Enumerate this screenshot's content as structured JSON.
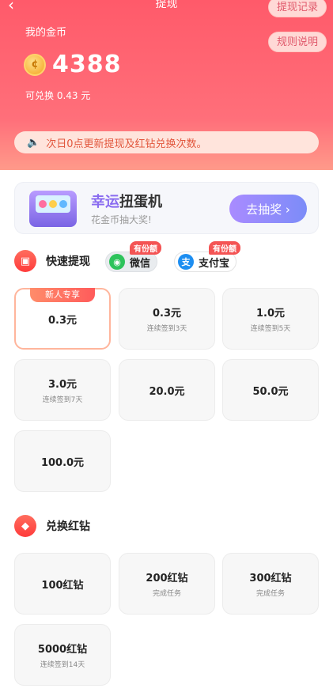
{
  "header": {
    "back_icon": "chevron-left-icon",
    "title": "提现",
    "record_button": "提现记录",
    "rules_button": "规则说明",
    "coin_label": "我的金币",
    "coin_value": "4388",
    "exchange_text": "可兑换 0.43 元",
    "notice": "次日0点更新提现及红钻兑换次数。"
  },
  "lottery": {
    "title_accent": "幸运",
    "title_rest": "扭蛋机",
    "subtitle": "花金币抽大奖!",
    "button": "去抽奖 ›"
  },
  "withdraw": {
    "title": "快速提现",
    "methods": [
      {
        "label": "微信",
        "tag": "有份额",
        "icon": "wechat-icon"
      },
      {
        "label": "支付宝",
        "tag": "有份额",
        "icon": "alipay-icon"
      }
    ],
    "options": [
      {
        "amount": "0.3元",
        "sub": "",
        "badge": "新人专享",
        "selected": true
      },
      {
        "amount": "0.3元",
        "sub": "连续签到3天"
      },
      {
        "amount": "1.0元",
        "sub": "连续签到5天"
      },
      {
        "amount": "3.0元",
        "sub": "连续签到7天"
      },
      {
        "amount": "20.0元",
        "sub": ""
      },
      {
        "amount": "50.0元",
        "sub": ""
      },
      {
        "amount": "100.0元",
        "sub": ""
      }
    ]
  },
  "diamond": {
    "title": "兑换红钻",
    "options": [
      {
        "amount": "100红钻",
        "sub": ""
      },
      {
        "amount": "200红钻",
        "sub": "完成任务"
      },
      {
        "amount": "300红钻",
        "sub": "完成任务"
      },
      {
        "amount": "5000红钻",
        "sub": "连续签到14天"
      }
    ]
  },
  "colors": {
    "header_red": "#ff5a6a",
    "accent_purple": "#8a6cf0",
    "wechat_green": "#2dc35b",
    "alipay_blue": "#1d8ef1"
  }
}
